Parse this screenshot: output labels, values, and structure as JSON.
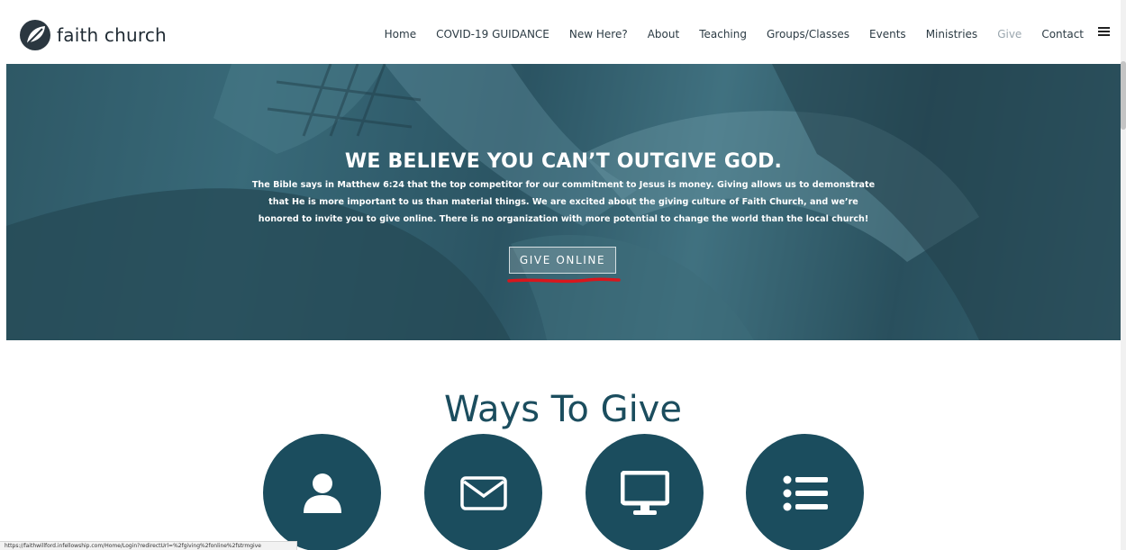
{
  "site": {
    "name": "faith church"
  },
  "nav": {
    "items": [
      {
        "label": "Home",
        "active": false
      },
      {
        "label": "COVID-19 GUIDANCE",
        "active": false
      },
      {
        "label": "New Here?",
        "active": false
      },
      {
        "label": "About",
        "active": false
      },
      {
        "label": "Teaching",
        "active": false
      },
      {
        "label": "Groups/Classes",
        "active": false
      },
      {
        "label": "Events",
        "active": false
      },
      {
        "label": "Ministries",
        "active": false
      },
      {
        "label": "Give",
        "active": true
      },
      {
        "label": "Contact",
        "active": false
      }
    ],
    "menu_icon": "hamburger-menu-icon"
  },
  "hero": {
    "title": "WE BELIEVE YOU CAN’T OUTGIVE GOD.",
    "body": "The Bible says in Matthew 6:24 that the top competitor for our commitment to Jesus is money. Giving allows us to demonstrate that He is more important to us than material things. We are excited about the giving culture of Faith Church, and we’re honored to invite you to give online. There is no organization with more potential to change the world than the local church!",
    "button_label": "GIVE ONLINE",
    "annotation_color": "#d9161c"
  },
  "ways": {
    "title": "Ways To Give",
    "options": [
      {
        "icon": "user-icon"
      },
      {
        "icon": "envelope-icon"
      },
      {
        "icon": "monitor-icon"
      },
      {
        "icon": "list-icon"
      }
    ]
  },
  "status": {
    "url": "https://faithwillford.infellowship.com/Home/Login?redirectUrl=%2fgiving%2fonline%2fstrmgive"
  },
  "colors": {
    "brand": "#1b4d5e",
    "nav_text": "#2c3b44",
    "nav_active": "#9aa6ae"
  }
}
